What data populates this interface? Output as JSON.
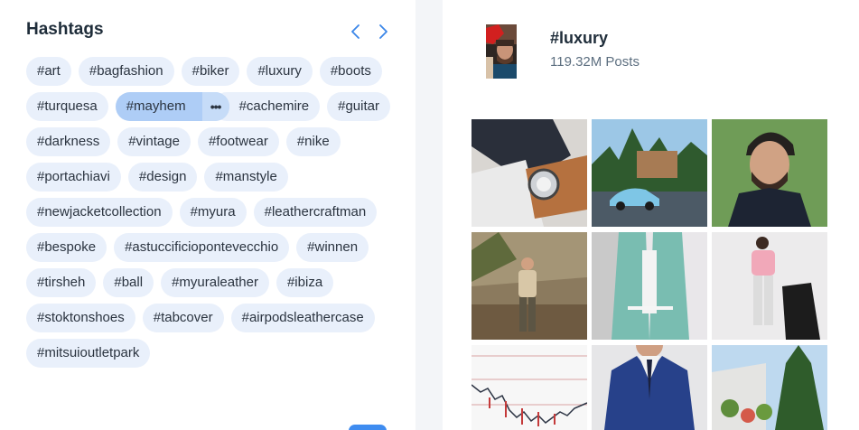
{
  "panel": {
    "title": "Hashtags",
    "prev_icon": "chevron-left-icon",
    "next_icon": "chevron-right-icon"
  },
  "tags": [
    "#art",
    "#bagfashion",
    "#biker",
    "#luxury",
    "#boots",
    "#turquesa",
    "#mayhem",
    "#cachemire",
    "#guitar",
    "#darkness",
    "#vintage",
    "#footwear",
    "#nike",
    "#portachiavi",
    "#design",
    "#manstyle",
    "#newjacketcollection",
    "#myura",
    "#leathercraftman",
    "#bespoke",
    "#astuccificiopontevecchio",
    "#winnen",
    "#tirsheh",
    "#ball",
    "#myuraleather",
    "#ibiza",
    "#stoktonshoes",
    "#tabcover",
    "#airpodsleathercase",
    "#mitsuioutletpark"
  ],
  "selected_tag": "#mayhem",
  "more_icon": "more-horizontal-icon",
  "detail": {
    "name": "#luxury",
    "count": "119.32M Posts"
  },
  "colors": {
    "tag_bg": "#e9f0fb",
    "tag_selected_bg": "#aecdf6",
    "accent": "#3f8cf0"
  }
}
